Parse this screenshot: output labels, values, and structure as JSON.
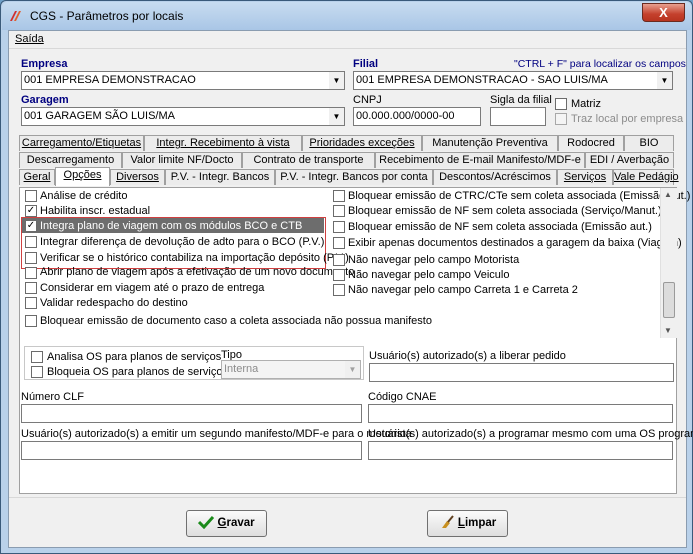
{
  "window": {
    "title": "CGS - Parâmetros por locais",
    "close_glyph": "X"
  },
  "menu": {
    "saida": "Saída"
  },
  "empresa": {
    "label": "Empresa",
    "value": "001 EMPRESA DEMONSTRACAO"
  },
  "filial": {
    "label": "Filial",
    "hint": "\"CTRL + F\" para localizar os campos",
    "value": "001 EMPRESA DEMONSTRACAO - SAO LUIS/MA"
  },
  "garagem": {
    "label": "Garagem",
    "value": "001 GARAGEM SÃO LUIS/MA"
  },
  "cnpj": {
    "label": "CNPJ",
    "value": "00.000.000/0000-00"
  },
  "sigla": {
    "label": "Sigla da filial",
    "value": ""
  },
  "matriz": {
    "label": "Matriz"
  },
  "traz_local": {
    "label": "Traz local por empresa"
  },
  "tabs_row1": [
    {
      "label": "Carregamento/Etiquetas"
    },
    {
      "label": "Integr. Recebimento à vista"
    },
    {
      "label": "Prioridades exceções"
    },
    {
      "label": "Manutenção Preventiva"
    },
    {
      "label": "Rodocred"
    },
    {
      "label": "BIO"
    }
  ],
  "tabs_row2": [
    {
      "label": "Descarregamento"
    },
    {
      "label": "Valor limite NF/Docto"
    },
    {
      "label": "Contrato de transporte"
    },
    {
      "label": "Recebimento de E-mail Manifesto/MDF-e"
    },
    {
      "label": "EDI / Averbação"
    }
  ],
  "tabs_row3": [
    {
      "label": "Geral"
    },
    {
      "label": "Opções"
    },
    {
      "label": "Diversos"
    },
    {
      "label": "P.V. - Integr. Bancos"
    },
    {
      "label": "P.V. - Integr. Bancos por conta"
    },
    {
      "label": "Descontos/Acréscimos"
    },
    {
      "label": "Serviços"
    },
    {
      "label": "Vale Pedágio"
    }
  ],
  "options_left": [
    {
      "label": "Análise de crédito",
      "checked": false
    },
    {
      "label": "Habilita inscr. estadual",
      "checked": true
    },
    {
      "label": "Integra plano de viagem com os módulos BCO e CTB",
      "checked": true
    },
    {
      "label": "Integrar diferença de devolução de adto para o BCO (P.V.)",
      "checked": false
    },
    {
      "label": "Verificar se o histórico contabiliza na importação depósito (P.V.)",
      "checked": false
    },
    {
      "label": "Abrir plano de viagem após a efetivação de um novo documento",
      "checked": false
    },
    {
      "label": "Considerar em viagem até o prazo de entrega",
      "checked": false
    },
    {
      "label": "Validar redespacho do destino",
      "checked": false
    },
    {
      "label": "Bloquear emissão de documento caso a coleta associada não possua manifesto",
      "checked": false
    }
  ],
  "options_right": [
    {
      "label": "Bloquear emissão de CTRC/CTe sem coleta associada (Emissão aut.)",
      "checked": false
    },
    {
      "label": "Bloquear emissão de NF sem coleta associada (Serviço/Manut.)",
      "checked": false
    },
    {
      "label": "Bloquear emissão de NF sem coleta associada (Emissão aut.)",
      "checked": false
    },
    {
      "label": "Exibir apenas documentos destinados a garagem da baixa (Viagem)",
      "checked": false
    },
    {
      "label": "Não navegar pelo campo Motorista",
      "checked": false
    },
    {
      "label": "Não navegar pelo campo Veiculo",
      "checked": false
    },
    {
      "label": "Não navegar pelo campo Carreta 1 e Carreta 2",
      "checked": false
    }
  ],
  "os": {
    "analisa": "Analisa OS para planos de serviços",
    "bloqueia": "Bloqueia OS para planos de serviços",
    "tipo_label": "Tipo",
    "tipo_value": "Interna"
  },
  "usuarios_liberar": {
    "label": "Usuário(s) autorizado(s) a liberar pedido",
    "value": ""
  },
  "numero_clf": {
    "label": "Número CLF",
    "value": ""
  },
  "codigo_cnae": {
    "label": "Código CNAE",
    "value": ""
  },
  "usuarios_manifesto": {
    "label": "Usuário(s) autorizado(s) a emitir um segundo manifesto/MDF-e para o motorista",
    "value": ""
  },
  "usuarios_programar": {
    "label": "Usuário(s) autorizado(s) a programar mesmo com uma OS programada",
    "value": ""
  },
  "buttons": {
    "gravar_first": "G",
    "gravar_rest": "ravar",
    "limpar_first": "L",
    "limpar_rest": "impar"
  }
}
